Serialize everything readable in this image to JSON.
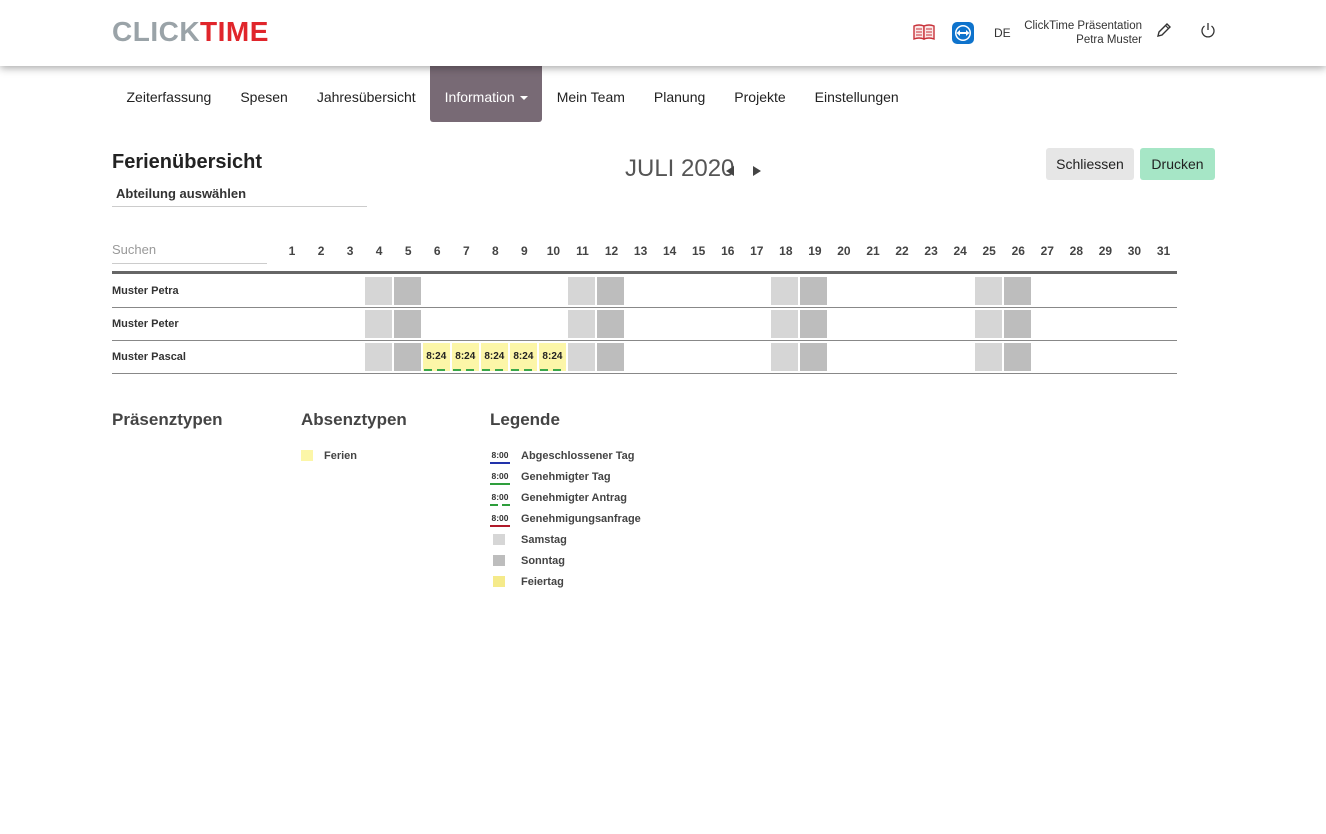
{
  "header": {
    "logo_part1": "CLICK",
    "logo_part2": "TIME",
    "language": "DE",
    "user_line1": "ClickTime Präsentation",
    "user_line2": "Petra Muster",
    "icons": [
      "manual-book-icon",
      "teamviewer-icon",
      "edit-pencil-icon",
      "power-icon"
    ],
    "brand_red": "#e0252b",
    "brand_grey": "#9aa3a8"
  },
  "nav": {
    "items": [
      {
        "label": "Zeiterfassung"
      },
      {
        "label": "Spesen"
      },
      {
        "label": "Jahresübersicht"
      },
      {
        "label": "Information",
        "active": true,
        "dropdown": true
      },
      {
        "label": "Mein Team"
      },
      {
        "label": "Planung"
      },
      {
        "label": "Projekte"
      },
      {
        "label": "Einstellungen"
      }
    ],
    "active_color": "#786a75"
  },
  "page": {
    "title": "Ferienübersicht",
    "department_label": "Abteilung auswählen",
    "month_label": "JULI 2020",
    "close_label": "Schliessen",
    "print_label": "Drucken",
    "search_placeholder": "Suchen"
  },
  "calendar": {
    "days": [
      "1",
      "2",
      "3",
      "4",
      "5",
      "6",
      "7",
      "8",
      "9",
      "10",
      "11",
      "12",
      "13",
      "14",
      "15",
      "16",
      "17",
      "18",
      "19",
      "20",
      "21",
      "22",
      "23",
      "24",
      "25",
      "26",
      "27",
      "28",
      "29",
      "30",
      "31"
    ],
    "saturdays": [
      4,
      11,
      18,
      25
    ],
    "sundays": [
      5,
      12,
      19,
      26
    ],
    "rows": [
      {
        "name": "Muster Petra",
        "entries": []
      },
      {
        "name": "Muster Peter",
        "entries": []
      },
      {
        "name": "Muster Pascal",
        "entries": [
          {
            "day": 6,
            "value": "8:24"
          },
          {
            "day": 7,
            "value": "8:24"
          },
          {
            "day": 8,
            "value": "8:24"
          },
          {
            "day": 9,
            "value": "8:24"
          },
          {
            "day": 10,
            "value": "8:24"
          }
        ]
      }
    ],
    "colors": {
      "saturday": "#d6d6d6",
      "sunday": "#bdbdbd",
      "vacation": "#fcf6a8"
    }
  },
  "presence": {
    "title": "Präsenztypen"
  },
  "absence": {
    "title": "Absenztypen",
    "items": [
      {
        "label": "Ferien",
        "color": "#fcf6a8"
      }
    ]
  },
  "legend": {
    "title": "Legende",
    "sample_value": "8:00",
    "items": [
      {
        "label": "Abgeschlossener Tag"
      },
      {
        "label": "Genehmigter Tag"
      },
      {
        "label": "Genehmigter Antrag"
      },
      {
        "label": "Genehmigungsanfrage"
      },
      {
        "label": "Samstag",
        "color": "#d6d6d6"
      },
      {
        "label": "Sonntag",
        "color": "#bdbdbd"
      },
      {
        "label": "Feiertag",
        "color": "#f5ea8a"
      }
    ]
  }
}
